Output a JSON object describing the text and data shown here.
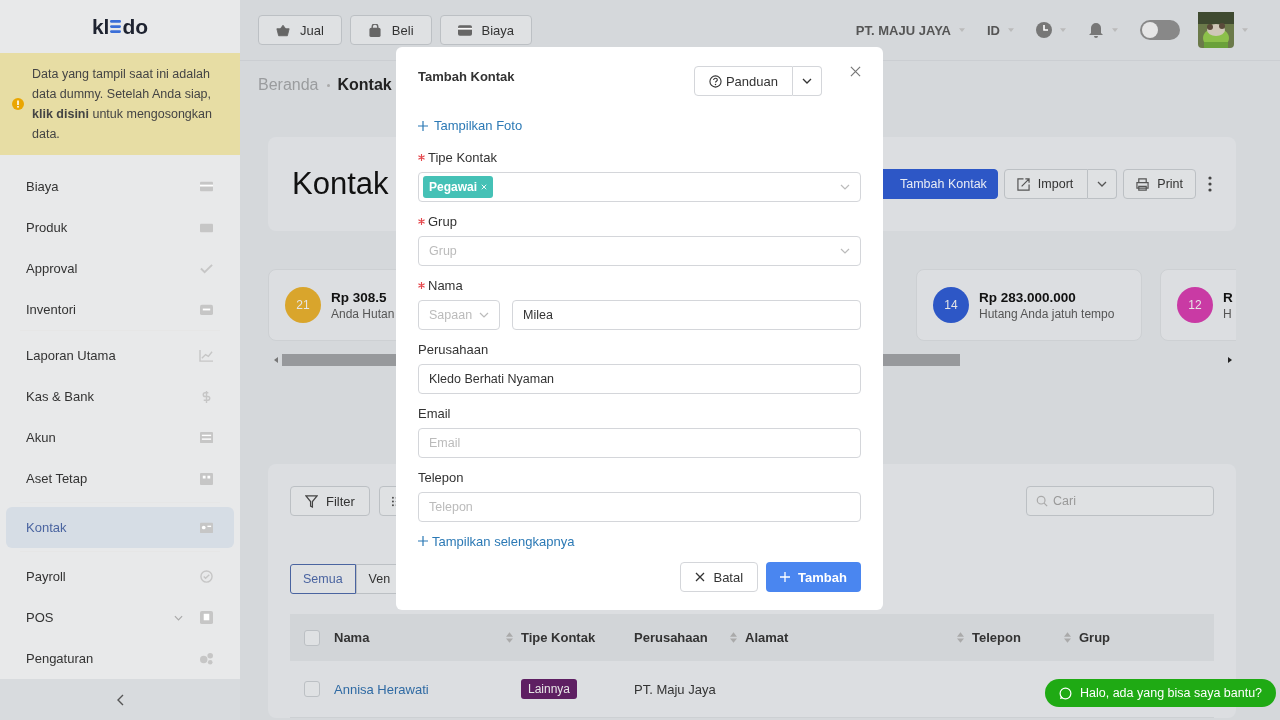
{
  "sidebar": {
    "logo": {
      "left": "kl",
      "right": "do"
    },
    "notice": "Data yang tampil saat ini adalah data dummy. Setelah Anda siap, **klik disini** untuk mengosongkan data.",
    "sections": [
      [
        {
          "label": "Biaya",
          "kind": "link",
          "selected": false
        },
        {
          "label": "Produk",
          "kind": "link",
          "selected": false
        },
        {
          "label": "Approval",
          "kind": "link",
          "selected": false
        },
        {
          "label": "Inventori",
          "kind": "link",
          "selected": false
        }
      ],
      [
        {
          "label": "Laporan Utama",
          "kind": "link",
          "selected": false
        },
        {
          "label": "Kas & Bank",
          "kind": "link",
          "selected": false
        },
        {
          "label": "Akun",
          "kind": "link",
          "selected": false
        },
        {
          "label": "Aset Tetap",
          "kind": "link",
          "selected": false
        }
      ],
      [
        {
          "label": "Kontak",
          "kind": "link",
          "selected": true
        }
      ],
      [
        {
          "label": "Payroll",
          "kind": "link",
          "selected": false
        },
        {
          "label": "POS",
          "kind": "submenu",
          "selected": false
        },
        {
          "label": "Pengaturan",
          "kind": "link",
          "selected": false
        }
      ]
    ]
  },
  "topbar": {
    "actions": [
      "Jual",
      "Beli",
      "Biaya"
    ],
    "company": "PT. MAJU JAYA",
    "language": "ID",
    "dark_mode": false
  },
  "breadcrumb": [
    "Beranda",
    "Kontak"
  ],
  "header": {
    "title": "Kontak",
    "buttons": [
      {
        "kind": "primary",
        "label": "Tambah Kontak"
      },
      {
        "kind": "split",
        "label": "Import"
      },
      {
        "kind": "plain",
        "label": "Print"
      }
    ]
  },
  "stats": [
    {
      "count": "21",
      "amount": "Rp 308.5",
      "caption": "Anda Hutan",
      "color": "#d9a52c"
    },
    {
      "count": "14",
      "amount": "Rp 283.000.000",
      "caption": "Hutang Anda jatuh tempo",
      "color": "#2d57c6"
    },
    {
      "count": "12",
      "amount": "R",
      "caption": "H",
      "color": "#c93aa4"
    }
  ],
  "table": {
    "filter": "Filter",
    "search_placeholder": "Cari",
    "tabs": [
      {
        "label": "Semua",
        "selected": true
      },
      {
        "label": "Ven",
        "selected": false
      }
    ],
    "header_checked": false,
    "columns": [
      {
        "label": "Nama",
        "sortable": true
      },
      {
        "label": "Tipe Kontak",
        "sortable": false
      },
      {
        "label": "Perusahaan",
        "sortable": true
      },
      {
        "label": "Alamat",
        "sortable": true
      },
      {
        "label": "Telepon",
        "sortable": true
      },
      {
        "label": "Grup",
        "sortable": false
      }
    ],
    "rows": [
      {
        "checked": false,
        "name": "Annisa Herawati",
        "type": {
          "label": "Lainnya",
          "color": "#5e1f62"
        },
        "company": "PT. Maju Jaya"
      }
    ]
  },
  "chat": "Halo, ada yang bisa saya bantu?",
  "modal": {
    "title": "Tambah Kontak",
    "help": "Panduan",
    "photo_link": "Tampilkan Foto",
    "fields": [
      {
        "kind": "tags",
        "label": "Tipe Kontak",
        "required": true,
        "tags": [
          "Pegawai"
        ]
      },
      {
        "kind": "select",
        "label": "Grup",
        "required": true,
        "placeholder": "Grup"
      },
      {
        "kind": "name",
        "label": "Nama",
        "required": true,
        "salutation_placeholder": "Sapaan",
        "value": "Milea"
      },
      {
        "kind": "text",
        "label": "Perusahaan",
        "required": false,
        "value": "Kledo Berhati Nyaman"
      },
      {
        "kind": "text",
        "label": "Email",
        "required": false,
        "placeholder": "Email"
      },
      {
        "kind": "text",
        "label": "Telepon",
        "required": false,
        "placeholder": "Telepon"
      }
    ],
    "more_link": "Tampilkan selengkapnya",
    "cancel": "Batal",
    "submit": "Tambah"
  }
}
